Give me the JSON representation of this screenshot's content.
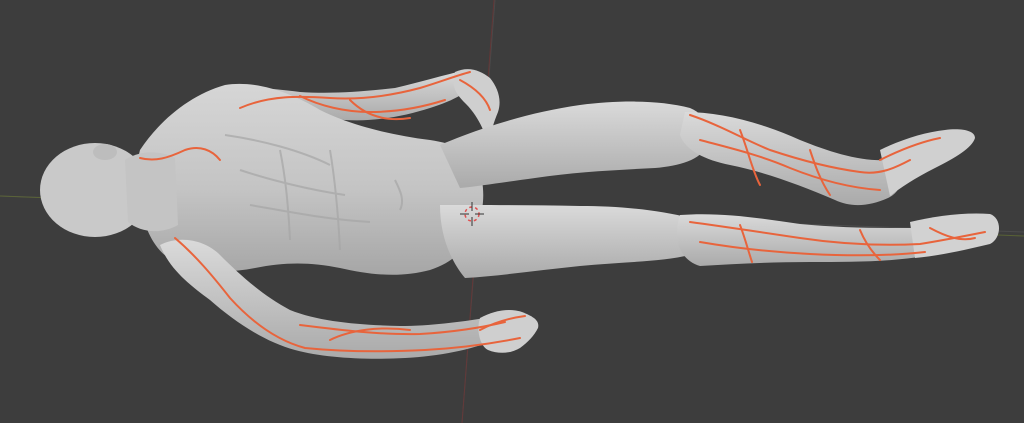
{
  "viewport": {
    "background": "#3d3d3d",
    "grid_line_color": "#4a4a4a",
    "x_axis_color": "#6e7a3c",
    "y_axis_color": "#7a3a3a",
    "icon": "3d-cursor-icon"
  },
  "model": {
    "body_color": "#c8c8c8",
    "body_shadow_color": "#a9a9a9",
    "vein_color": "#e8643c"
  }
}
